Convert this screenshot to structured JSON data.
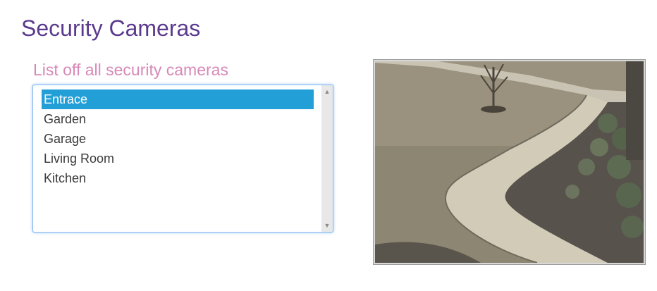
{
  "page": {
    "title": "Security Cameras"
  },
  "camera_list": {
    "heading": "List off all security cameras",
    "items": [
      {
        "label": "Entrace",
        "selected": true
      },
      {
        "label": "Garden",
        "selected": false
      },
      {
        "label": "Garage",
        "selected": false
      },
      {
        "label": "Living Room",
        "selected": false
      },
      {
        "label": "Kitchen",
        "selected": false
      }
    ],
    "scrollbar": {
      "up_icon": "chevron-up-icon",
      "down_icon": "chevron-down-icon"
    }
  },
  "camera_feed": {
    "alt": "Entrance camera feed"
  },
  "colors": {
    "title": "#5b3a8e",
    "heading": "#d889b8",
    "selection": "#239fd8",
    "focus_border": "#8cbcf0"
  }
}
